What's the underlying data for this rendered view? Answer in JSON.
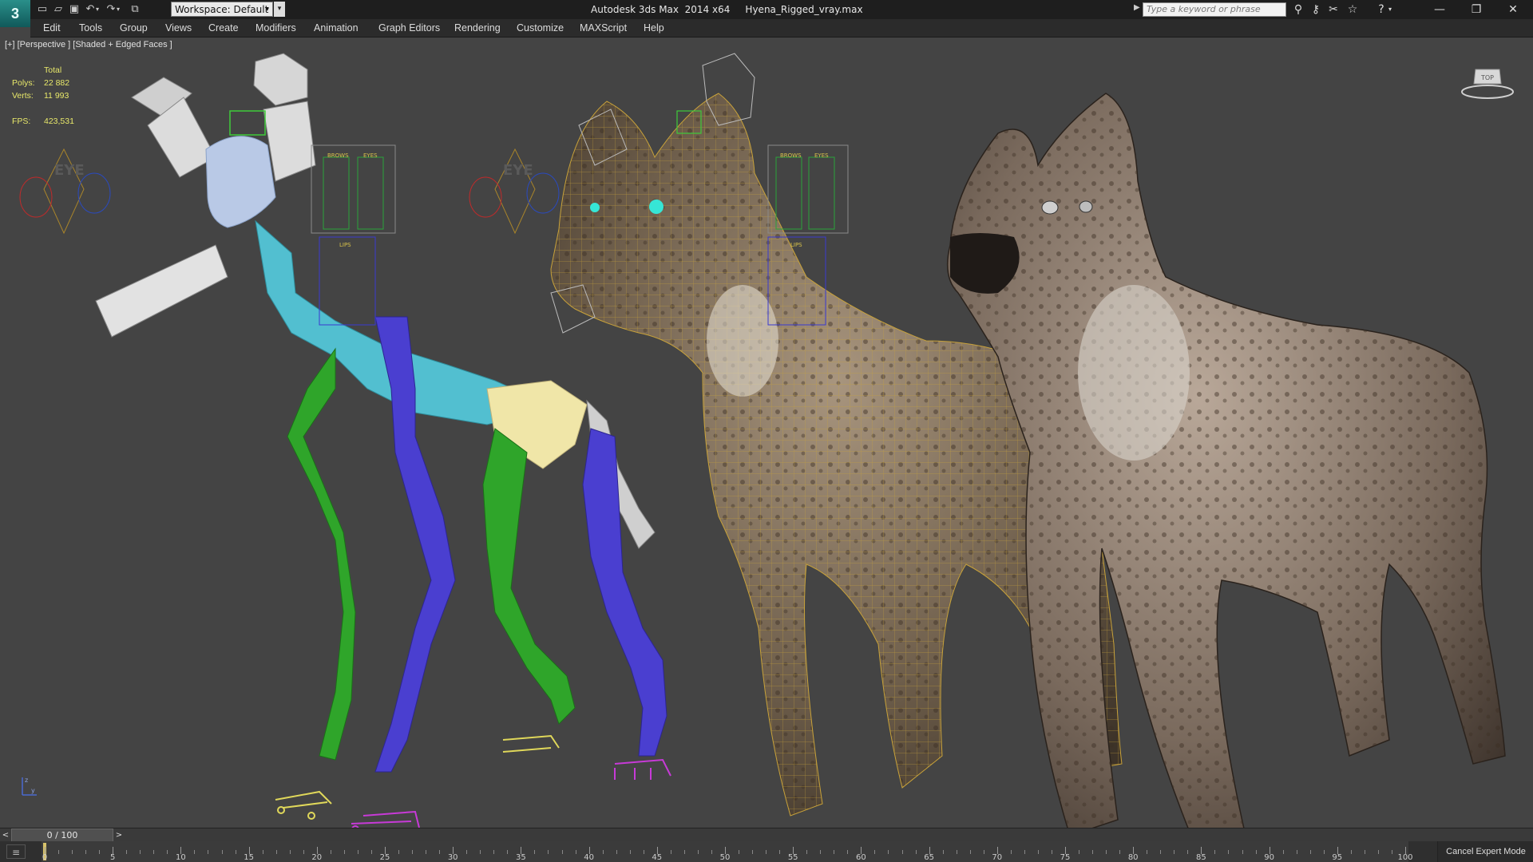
{
  "titlebar": {
    "app_logo_letter": "3",
    "workspace_label": "Workspace: Default",
    "window_title": "Autodesk 3ds Max  2014 x64     Hyena_Rigged_vray.max",
    "search_placeholder": "Type a keyword or phrase",
    "quick_access_icons": [
      "new-file-icon",
      "open-folder-icon",
      "save-icon",
      "undo-icon",
      "redo-icon",
      "project-icon"
    ],
    "toolbar_icons": [
      "binoculars-icon",
      "key-icon",
      "infocenter-icon",
      "favorites-star-icon",
      "help-icon"
    ],
    "window_buttons": [
      "minimize-icon",
      "restore-icon",
      "close-icon"
    ]
  },
  "menu": {
    "items": [
      "Edit",
      "Tools",
      "Group",
      "Views",
      "Create",
      "Modifiers",
      "Animation",
      "Graph Editors",
      "Rendering",
      "Customize",
      "MAXScript",
      "Help"
    ]
  },
  "viewport": {
    "label": "[+] [Perspective ] [Shaded + Edged Faces ]",
    "stats": {
      "header": "Total",
      "polys_label": "Polys:",
      "polys_value": "22 882",
      "verts_label": "Verts:",
      "verts_value": "11 993",
      "fps_label": "FPS:",
      "fps_value": "423,531"
    },
    "rig_text": {
      "eye": "EYE",
      "brows": "BROWS",
      "eyes": "EYES",
      "lips": "LIPS"
    },
    "viewcube_label": "TOP",
    "axis": {
      "x": "x",
      "y": "y",
      "z": "z"
    },
    "colors": {
      "background": "#444444",
      "bone_green": "#2fa52a",
      "bone_blue": "#4a3fd0",
      "spine_cyan": "#52bfd0",
      "pelvis_yellow": "#f0e6a8",
      "helper_white": "#d9d9d9",
      "wire_gold": "#c8a23a",
      "eye_glow": "#36e6d6",
      "stats_yellow": "#e8e86a"
    }
  },
  "timeline": {
    "slider_text": "0 / 100",
    "current_frame": 0,
    "total_frames": 100,
    "ticks": [
      "0",
      "5",
      "10",
      "15",
      "20",
      "25",
      "30",
      "35",
      "40",
      "45",
      "50",
      "55",
      "60",
      "65",
      "70",
      "75",
      "80",
      "85",
      "90",
      "95",
      "100"
    ]
  },
  "status": {
    "cancel_expert_label": "Cancel Expert Mode"
  }
}
